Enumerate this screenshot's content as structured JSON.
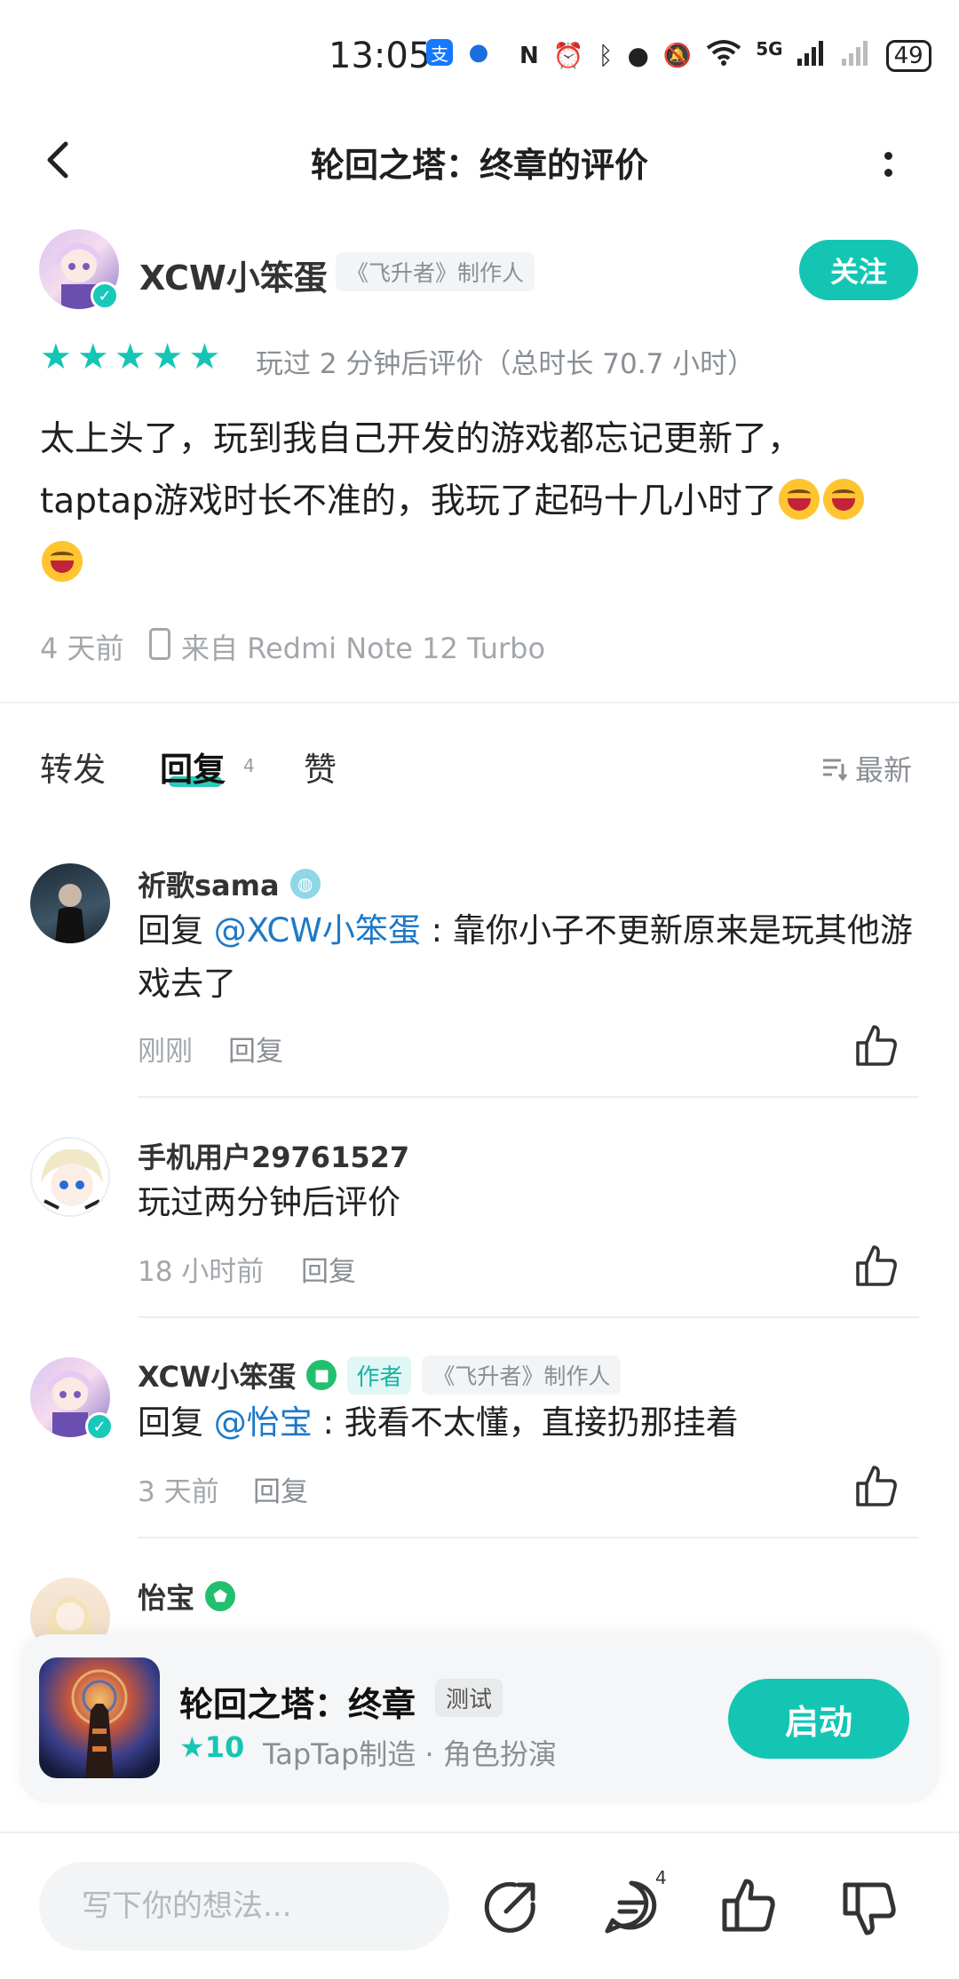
{
  "status_bar": {
    "time": "13:05",
    "battery": "49",
    "network": "5G"
  },
  "header": {
    "title": "轮回之塔：终章的评价"
  },
  "review": {
    "author": "XCW小笨蛋",
    "author_tag": "《飞升者》制作人",
    "follow_label": "关注",
    "rating_stars": 5,
    "playtime": "玩过 2 分钟后评价（总时长 70.7 小时）",
    "body_line1": "太上头了，玩到我自己开发的游戏都忘记更新了，",
    "body_line2": "taptap游戏时长不准的，我玩了起码十几小时了",
    "time": "4 天前",
    "device": "来自 Redmi Note 12 Turbo"
  },
  "tabs": {
    "forward": "转发",
    "reply": "回复",
    "reply_count": "4",
    "like": "赞",
    "sort": "最新"
  },
  "comments": [
    {
      "name": "祈歌sama",
      "reply_prefix": "回复 ",
      "mention": "@XCW小笨蛋",
      "text": " : 靠你小子不更新原来是玩其他游戏去了",
      "time": "刚刚",
      "reply_label": "回复"
    },
    {
      "name": "手机用户29761527",
      "text": "玩过两分钟后评价",
      "time": "18 小时前",
      "reply_label": "回复"
    },
    {
      "name": "XCW小笨蛋",
      "badge_author": "作者",
      "tag": "《飞升者》制作人",
      "reply_prefix": "回复 ",
      "mention": "@怡宝",
      "text": " : 我看不太懂，直接扔那挂着",
      "time": "3 天前",
      "reply_label": "回复"
    },
    {
      "name": "怡宝"
    }
  ],
  "game_card": {
    "name": "轮回之塔：终章",
    "tag": "测试",
    "rating": "10",
    "developer": "TapTap制造 · 角色扮演",
    "launch_label": "启动"
  },
  "bottom_bar": {
    "placeholder": "写下你的想法...",
    "comment_count": "4"
  },
  "colors": {
    "accent": "#15c5b4",
    "mention": "#1e78c8",
    "muted": "#a3a7ab"
  }
}
